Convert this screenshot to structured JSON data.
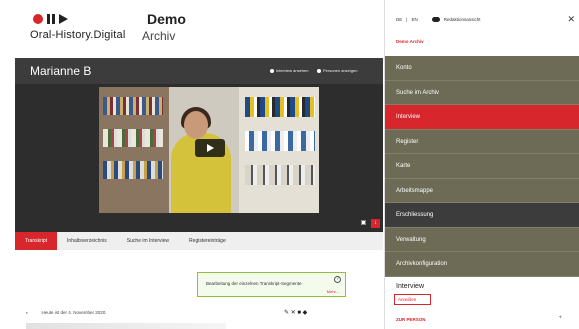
{
  "header": {
    "logo_text": "Oral-History.Digital",
    "project_title": "Demo",
    "project_subtitle": "Archiv"
  },
  "interview": {
    "name": "Marianne B",
    "options": [
      "Interview ansehen",
      "Personen anzeigen"
    ]
  },
  "tabs": [
    {
      "label": "Transkript",
      "active": true
    },
    {
      "label": "Inhaltsverzeichnis",
      "active": false
    },
    {
      "label": "Suche im Interview",
      "active": false
    },
    {
      "label": "Registereinträge",
      "active": false
    }
  ],
  "notice": {
    "text": "Bearbeitung der einzelnen Transkript-Segmente.",
    "link": "Mehr..."
  },
  "transcript": {
    "first_line": "Heute ist der 4. November 2020."
  },
  "sidebar": {
    "lang": {
      "de": "DE",
      "sep": "|",
      "en": "EN"
    },
    "redaktion_label": "Redaktionsansicht",
    "archive_link": "Demo Archiv",
    "menu": [
      {
        "label": "Konto",
        "state": "normal"
      },
      {
        "label": "Suche im Archiv",
        "state": "normal"
      },
      {
        "label": "Interview",
        "state": "active"
      },
      {
        "label": "Register",
        "state": "normal"
      },
      {
        "label": "Karte",
        "state": "normal"
      },
      {
        "label": "Arbeitsmappe",
        "state": "normal"
      },
      {
        "label": "Erschliessung",
        "state": "dark"
      },
      {
        "label": "Verwaltung",
        "state": "normal"
      },
      {
        "label": "Archivkonfiguration",
        "state": "normal"
      }
    ],
    "sub_title": "Interview",
    "sub_button": "Anreißen",
    "person_link": "ZUR PERSON"
  },
  "colors": {
    "accent": "#d7262c",
    "menu": "#6d6b55",
    "dark": "#3c3c3c"
  }
}
